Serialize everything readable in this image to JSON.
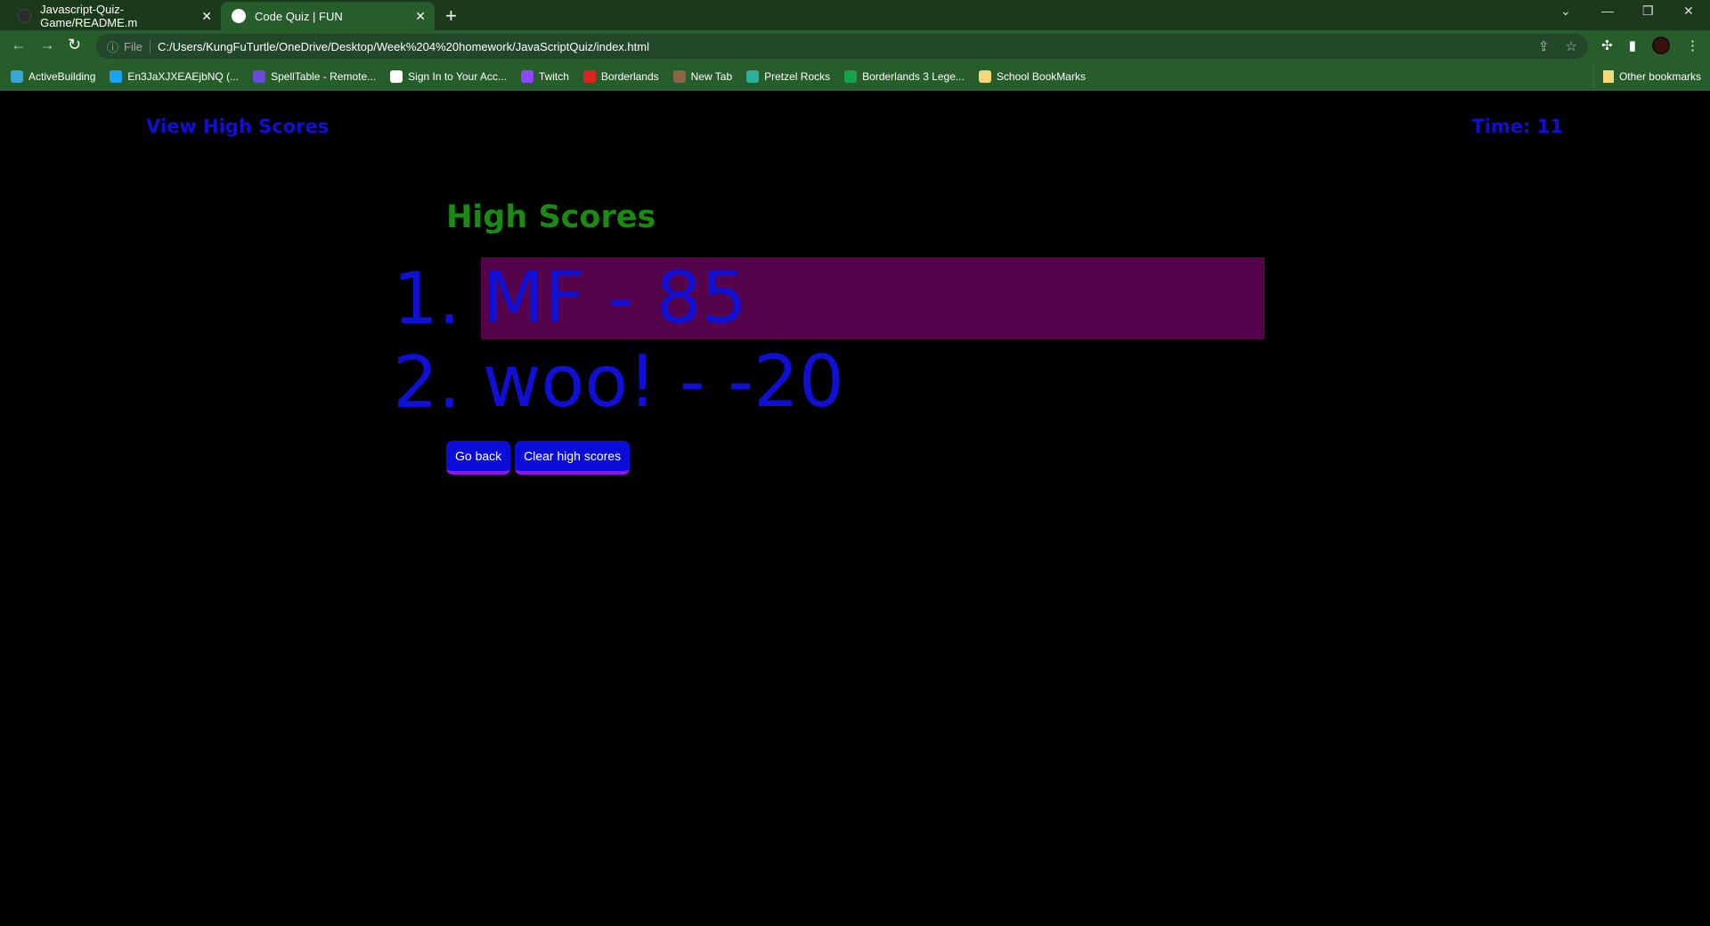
{
  "browser": {
    "tabs": [
      {
        "title": "Javascript-Quiz-Game/README.m"
      },
      {
        "title": "Code Quiz | FUN"
      }
    ],
    "address": {
      "scheme_label": "File",
      "url": "C:/Users/KungFuTurtle/OneDrive/Desktop/Week%204%20homework/JavaScriptQuiz/index.html"
    },
    "bookmarks": [
      {
        "label": "ActiveBuilding",
        "color": "#3aa6d6"
      },
      {
        "label": "En3JaXJXEAEjbNQ (...",
        "color": "#1da1f2"
      },
      {
        "label": "SpellTable - Remote...",
        "color": "#6b4bd6"
      },
      {
        "label": "Sign In to Your Acc...",
        "color": "#ffffff"
      },
      {
        "label": "Twitch",
        "color": "#9146ff"
      },
      {
        "label": "Borderlands",
        "color": "#d22"
      },
      {
        "label": "New Tab",
        "color": "#886644"
      },
      {
        "label": "Pretzel Rocks",
        "color": "#2bb0a0"
      },
      {
        "label": "Borderlands 3 Lege...",
        "color": "#16a34a"
      },
      {
        "label": "School BookMarks",
        "color": "#f5d77a"
      }
    ],
    "other_bookmarks": "Other bookmarks"
  },
  "page": {
    "view_high_scores": "View High Scores",
    "timer": "Time: 11",
    "heading": "High Scores",
    "scores": [
      {
        "rank": "1.",
        "entry": "MF - 85",
        "highlighted": true
      },
      {
        "rank": "2.",
        "entry": "woo! - -20",
        "highlighted": false
      }
    ],
    "go_back": "Go back",
    "clear": "Clear high scores"
  }
}
